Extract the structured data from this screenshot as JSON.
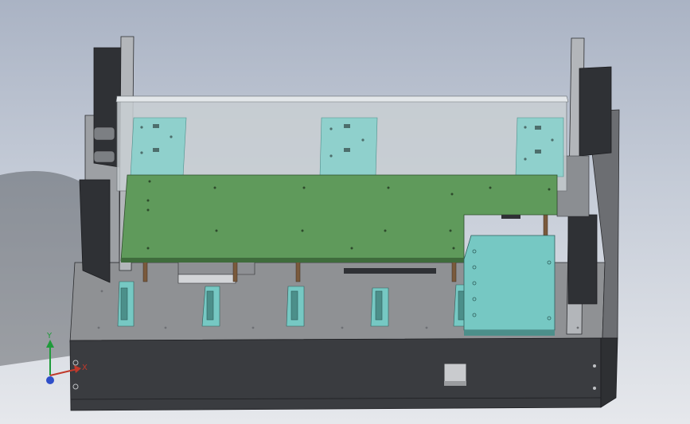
{
  "viewport": {
    "background_top": "#aab3c4",
    "background_bottom": "#e6e8ec"
  },
  "colors": {
    "base_dark": "#3b3d41",
    "deck_grey": "#929497",
    "cover_glass": "#c9cfd3",
    "pcb_green": "#5f9a5b",
    "teal_part": "#76c8c3",
    "post_brown": "#7a5a3c"
  },
  "triad": {
    "y_label": "Y",
    "x_label": "X",
    "y_color": "#1f9a3a",
    "x_color": "#c0392b",
    "z_color": "#2f4fc9"
  }
}
